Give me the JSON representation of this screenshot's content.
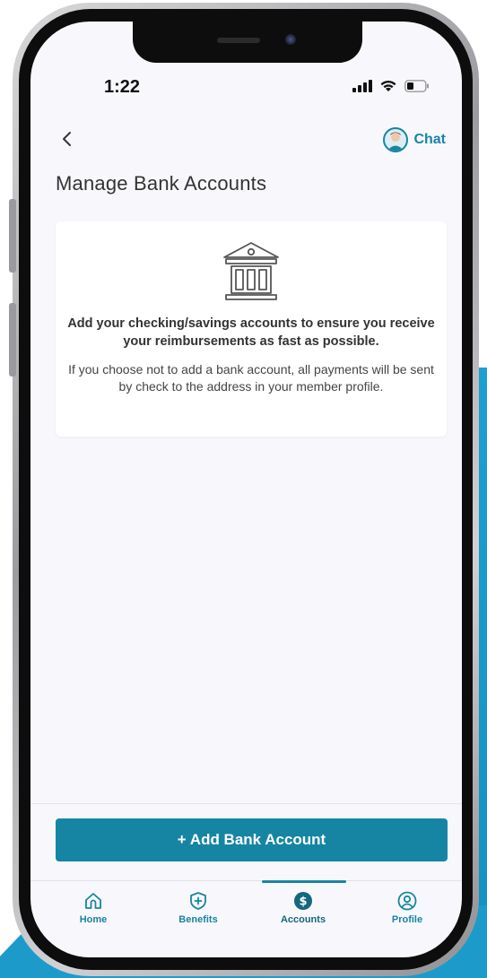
{
  "status_bar": {
    "time": "1:22"
  },
  "header": {
    "back_icon": "chevron-left-icon",
    "chat_label": "Chat",
    "chat_icon": "chat-avatar-icon"
  },
  "page": {
    "title": "Manage Bank Accounts"
  },
  "info_card": {
    "icon": "bank-icon",
    "headline": "Add your checking/savings accounts to ensure you receive your reimbursements as fast as possible.",
    "body": "If you choose not to add a bank account, all payments will be sent by check to the address in your member profile."
  },
  "actions": {
    "add_bank_account_label": "+ Add Bank Account"
  },
  "bottom_nav": {
    "active": "Accounts",
    "items": [
      {
        "label": "Home",
        "icon": "home-icon"
      },
      {
        "label": "Benefits",
        "icon": "shield-plus-icon"
      },
      {
        "label": "Accounts",
        "icon": "dollar-circle-icon"
      },
      {
        "label": "Profile",
        "icon": "user-circle-icon"
      }
    ]
  },
  "colors": {
    "primary": "#1685a3",
    "background": "#f8f8fc",
    "backdrop_accent": "#1c9bcb"
  }
}
